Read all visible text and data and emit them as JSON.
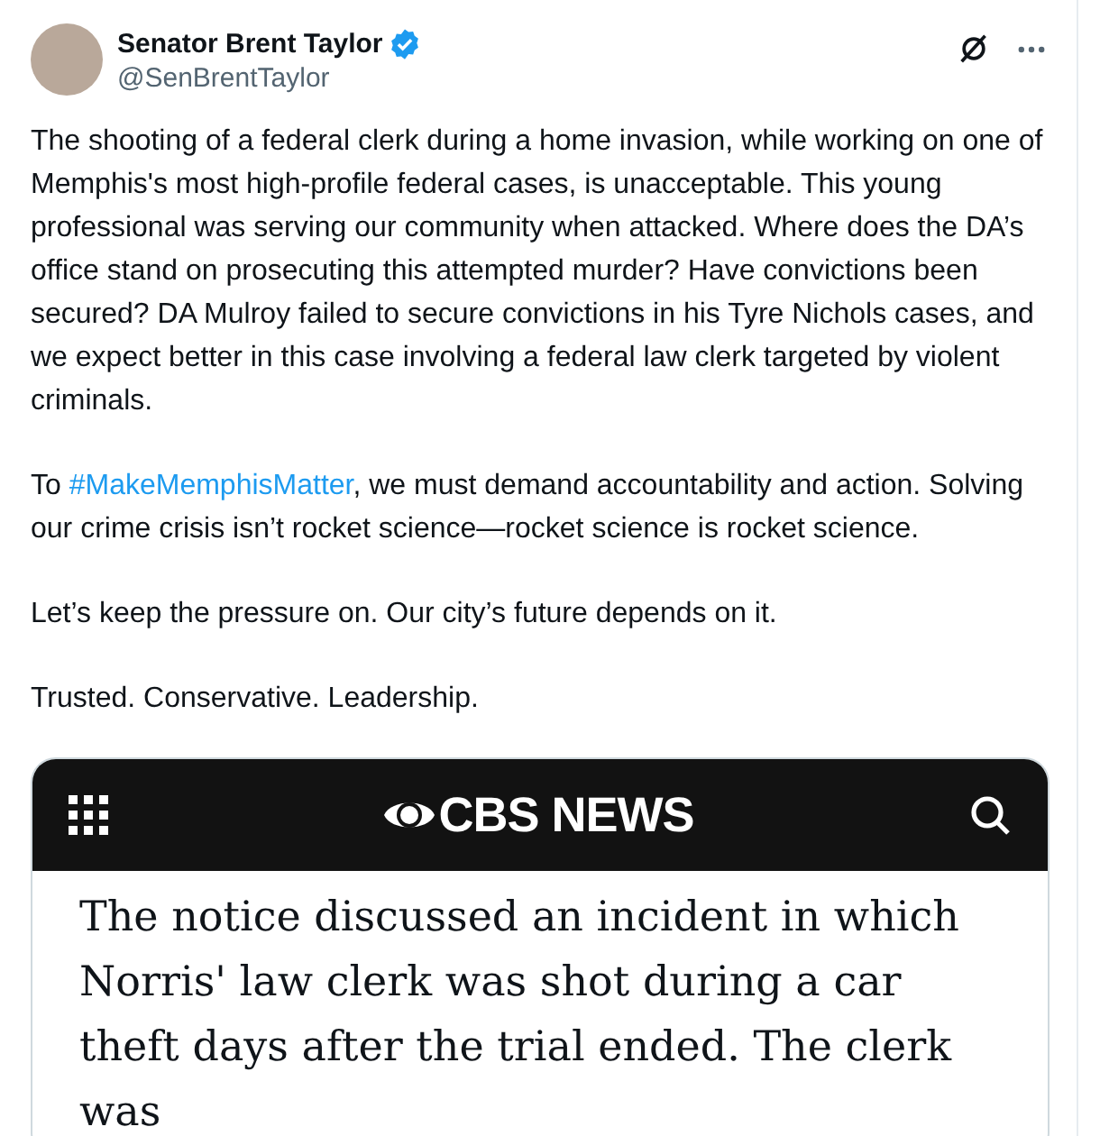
{
  "author": {
    "name": "Senator Brent Taylor",
    "handle": "@SenBrentTaylor",
    "verified": true
  },
  "paragraphs": [
    [
      {
        "kind": "text",
        "text": "The shooting of a federal clerk during a home invasion, while working on one of Memphis's most high-profile federal cases, is unacceptable. This young professional was serving our community when attacked. Where does the DA’s office stand on prosecuting this attempted murder? Have convictions been secured? DA Mulroy failed to secure convictions in his Tyre Nichols cases, and we expect better in this case involving a federal law clerk targeted by violent criminals."
      }
    ],
    [
      {
        "kind": "text",
        "text": "To "
      },
      {
        "kind": "hashtag",
        "text": "#MakeMemphisMatter"
      },
      {
        "kind": "text",
        "text": ", we must demand accountability and action. Solving our crime crisis isn’t rocket science—rocket science is rocket science."
      }
    ],
    [
      {
        "kind": "text",
        "text": "Let’s keep the pressure on. Our city’s future depends on it."
      }
    ],
    [
      {
        "kind": "text",
        "text": "Trusted. Conservative. Leadership."
      }
    ]
  ],
  "embed": {
    "logo": "CBS NEWS",
    "text": "The notice discussed an incident in which Norris' law clerk was shot during a car theft days after the trial ended. The clerk was"
  }
}
